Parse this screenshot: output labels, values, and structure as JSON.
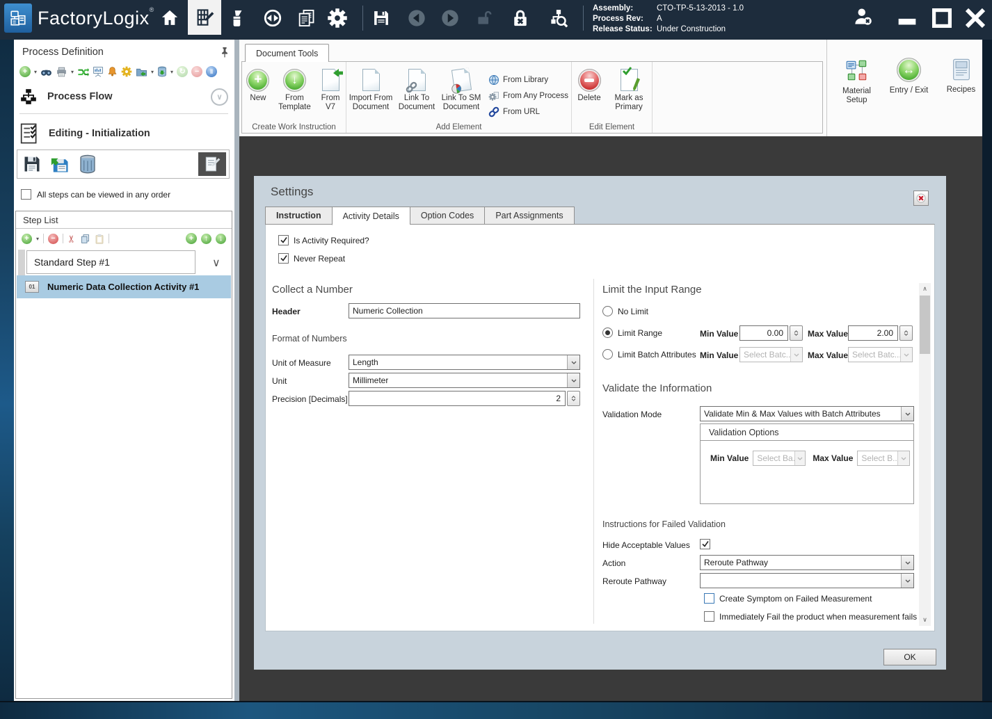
{
  "titlebar": {
    "app_name": "FactoryLogix",
    "reg_mark": "®",
    "info": {
      "assembly_label": "Assembly:",
      "assembly_value": "CTO-TP-5-13-2013 - 1.0",
      "process_rev_label": "Process Rev:",
      "process_rev_value": "A",
      "release_status_label": "Release Status:",
      "release_status_value": "Under Construction"
    }
  },
  "left_panel": {
    "title": "Process Definition",
    "process_flow_label": "Process Flow",
    "editing_label": "Editing - Initialization",
    "any_order_label": "All steps can be viewed in any order",
    "step_list": {
      "title": "Step List",
      "step_selector_value": "Standard Step #1",
      "activity_icon_text": "01",
      "activity_item": "Numeric Data Collection Activity #1"
    }
  },
  "ribbon": {
    "tab_label": "Document Tools",
    "groups": [
      {
        "label": "Create Work Instruction",
        "buttons": [
          "New",
          "From Template",
          "From V7"
        ]
      },
      {
        "label": "Add Element",
        "buttons": [
          "Import From Document",
          "Link To Document",
          "Link To SM Document"
        ],
        "links": [
          "From Library",
          "From Any Process",
          "From URL"
        ]
      },
      {
        "label": "Edit Element",
        "buttons": [
          "Delete",
          "Mark as Primary"
        ]
      }
    ],
    "right_buttons": [
      "Material Setup",
      "Entry / Exit",
      "Recipes"
    ]
  },
  "dialog": {
    "title": "Settings",
    "tabs": [
      "Instruction",
      "Activity Details",
      "Option Codes",
      "Part Assignments"
    ],
    "checks": {
      "is_activity_required": "Is Activity Required?",
      "never_repeat": "Never Repeat"
    },
    "collect": {
      "heading": "Collect a Number",
      "header_label": "Header",
      "header_value": "Numeric Collection",
      "format_heading": "Format of Numbers",
      "unit_of_measure_label": "Unit of Measure",
      "unit_of_measure_value": "Length",
      "unit_label": "Unit",
      "unit_value": "Millimeter",
      "precision_label": "Precision [Decimals]",
      "precision_value": "2"
    },
    "limit": {
      "heading": "Limit the Input Range",
      "no_limit_label": "No Limit",
      "limit_range_label": "Limit Range",
      "min_value_label": "Min Value",
      "max_value_label": "Max Value",
      "min_value": "0.00",
      "max_value": "2.00",
      "limit_batch_label": "Limit Batch Attributes",
      "batch_min_value": "Select Batc...",
      "batch_max_value": "Select Batc..."
    },
    "validate": {
      "heading": "Validate the Information",
      "mode_label": "Validation Mode",
      "mode_value": "Validate Min & Max Values with Batch Attributes",
      "options_title": "Validation Options",
      "min_value_label": "Min Value",
      "max_value_label": "Max Value",
      "min_value": "Select Ba...",
      "max_value": "Select B..."
    },
    "failed": {
      "heading": "Instructions for Failed Validation",
      "hide_label": "Hide Acceptable Values",
      "action_label": "Action",
      "action_value": "Reroute Pathway",
      "reroute_label": "Reroute Pathway",
      "create_symptom_label": "Create Symptom on Failed Measurement",
      "immediately_fail_label": "Immediately Fail the product when measurement fails"
    },
    "ok_label": "OK"
  },
  "icons": {
    "caret": "▾",
    "plus": "+",
    "minus": "−",
    "up_arrow": "↑",
    "down_arrow": "↓",
    "left_right_arrow": "↔",
    "scissors": "✂",
    "refresh": "↻",
    "pause": "‖",
    "chevron_up": "∧",
    "chevron_down": "∨"
  },
  "colors": {
    "titlebar_bg": "#1d2c3c",
    "frame_blue": "#1d5a8a",
    "content_dark": "#3a3a3a",
    "dialog_bg": "#c8d3dc",
    "selection_blue": "#a9cbe2",
    "accent_green": "#41a62a",
    "accent_red": "#c32222"
  }
}
